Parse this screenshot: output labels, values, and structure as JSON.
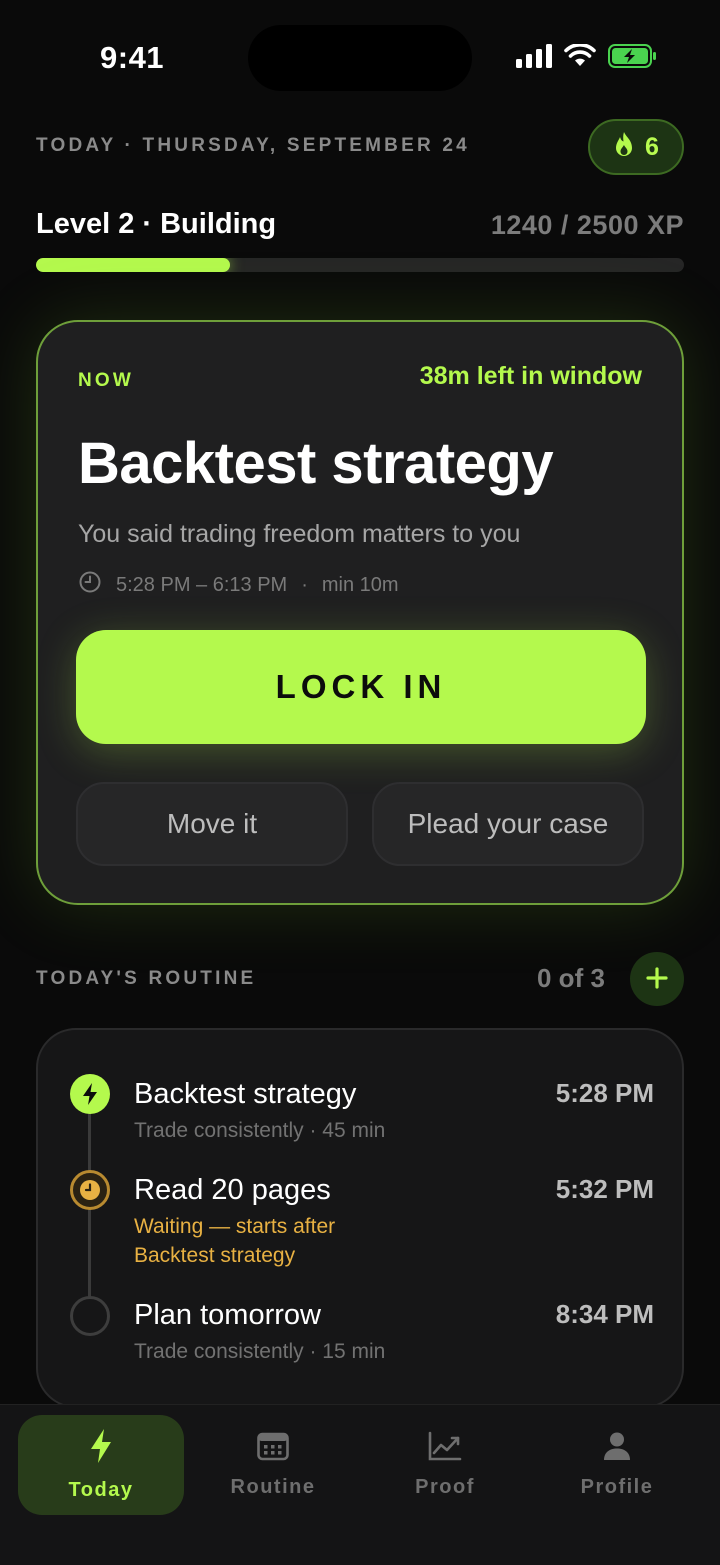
{
  "status_bar": {
    "time": "9:41"
  },
  "header": {
    "date_line": "TODAY · THURSDAY, SEPTEMBER 24",
    "streak": "6",
    "level_title": "Level 2 · Building",
    "xp_text": "1240 / 2500 XP",
    "xp_progress": 0.3
  },
  "now_card": {
    "label": "NOW",
    "window_left": "38m left in window",
    "task_title": "Backtest strategy",
    "reason": "You said trading freedom matters to you",
    "time_range": "5:28 PM – 6:13 PM",
    "separator": "·",
    "min_duration": "min 10m",
    "lock_label": "LOCK IN",
    "move_label": "Move it",
    "plead_label": "Plead your case"
  },
  "routine": {
    "label": "TODAY'S ROUTINE",
    "count": "0 of 3",
    "items": [
      {
        "title": "Backtest strategy",
        "subtitle": "Trade consistently · 45 min",
        "time": "5:28 PM",
        "state": "active"
      },
      {
        "title": "Read 20 pages",
        "subtitle_line1": "Waiting — starts after",
        "subtitle_line2": "Backtest strategy",
        "time": "5:32 PM",
        "state": "waiting"
      },
      {
        "title": "Plan tomorrow",
        "subtitle": "Trade consistently · 15 min",
        "time": "8:34 PM",
        "state": "pending"
      }
    ]
  },
  "nav": {
    "items": [
      {
        "label": "Today",
        "icon": "lightning-icon",
        "active": true
      },
      {
        "label": "Routine",
        "icon": "calendar-icon",
        "active": false
      },
      {
        "label": "Proof",
        "icon": "chart-icon",
        "active": false
      },
      {
        "label": "Profile",
        "icon": "person-icon",
        "active": false
      }
    ]
  },
  "colors": {
    "accent": "#b4f94d",
    "waiting": "#e8b143",
    "background": "#0a0a0a",
    "card": "#1f1f20"
  }
}
